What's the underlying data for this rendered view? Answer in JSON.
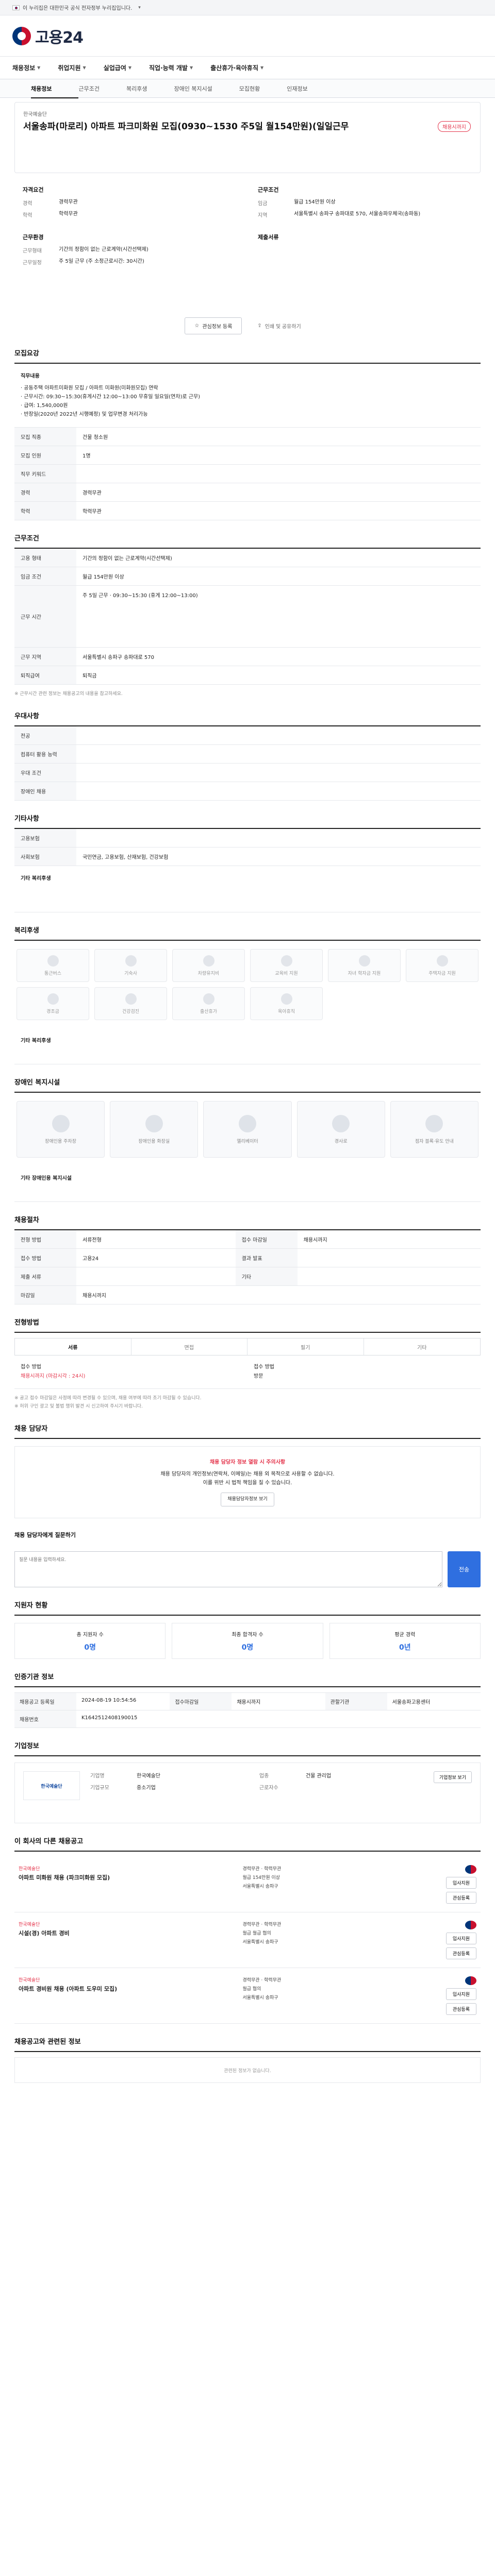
{
  "notice": "이 누리집은 대한민국 공식 전자정부 누리집입니다.",
  "site": {
    "name": "고용24"
  },
  "gnb": [
    {
      "label": "채용정보"
    },
    {
      "label": "취업지원"
    },
    {
      "label": "실업급여"
    },
    {
      "label": "직업·능력 개발"
    },
    {
      "label": "출산휴가·육아휴직"
    }
  ],
  "lnb": [
    {
      "label": "채용정보"
    },
    {
      "label": "근무조건"
    },
    {
      "label": "복리후생"
    },
    {
      "label": "장애인 복지시설"
    },
    {
      "label": "모집현황"
    },
    {
      "label": "인재정보"
    }
  ],
  "job": {
    "company": "한국예술단",
    "title": "서울송파(마로리) 아파트 파크미화원 모집(0930~1530 주5일 월154만원)(일일근무",
    "badge": "채용시까지"
  },
  "summary": {
    "left_title": "자격요건",
    "left": [
      {
        "k": "경력",
        "v": "경력무관"
      },
      {
        "k": "학력",
        "v": "학력무관"
      }
    ],
    "left2_title": "근무환경",
    "left2": [
      {
        "k": "근무형태",
        "v": "기간의 정함이 없는 근로계약(시간선택제)"
      },
      {
        "k": "근무일정",
        "v": "주 5일 근무 (주 소정근로시간: 30시간)"
      }
    ],
    "right_title": "근무조건",
    "right": [
      {
        "k": "임금",
        "v": "월급 154만원 이상"
      },
      {
        "k": "지역",
        "v": "서울특별시 송파구 송파대로 570, 서울송파우체국(송파동)"
      }
    ],
    "right2_title": "제출서류",
    "right2": [
      {
        "k": "",
        "v": ""
      }
    ]
  },
  "actions": {
    "apply": "관심정보 등록",
    "share": "인쇄 및 공유하기"
  },
  "recruit": {
    "title": "모집요강",
    "content_title": "직무내용",
    "content_lines": [
      "· 공동주택 아파트미화원 모집 / 아파트 미화원(미화원모집) 연락",
      "· 근무시간: 09:30~15:30(휴게시간 12:00~13:00 무휴일 일요일(연차)로 근무)",
      "· 급여: 1,540,000원",
      "· 반장일(2020년 2022년 시행예정) 및 업무변경 처리가능"
    ],
    "rows": [
      {
        "k": "모집 직종",
        "v": "건물 청소원"
      },
      {
        "k": "모집 인원",
        "v": "1명"
      },
      {
        "k": "직무 키워드",
        "v": ""
      },
      {
        "k": "경력",
        "v": "경력무관"
      },
      {
        "k": "학력",
        "v": "학력무관"
      }
    ]
  },
  "work": {
    "title": "근무조건",
    "rows": [
      {
        "k": "고용 형태",
        "v": "기간의 정함이 없는 근로계약(시간선택제)"
      },
      {
        "k": "임금 조건",
        "v": "월급 154만원 이상"
      },
      {
        "k": "근무 시간",
        "v": "주 5일 근무 · 09:30~15:30 (휴게 12:00~13:00)"
      },
      {
        "k": "근무 지역",
        "v": "서울특별시 송파구 송파대로 570"
      },
      {
        "k": "퇴직급여",
        "v": "퇴직금"
      }
    ],
    "note": "※ 근무시간 관련 정보는 채용공고의 내용을 참고하세요."
  },
  "skills": {
    "title": "우대사항",
    "rows": [
      {
        "k": "전공",
        "v": ""
      },
      {
        "k": "컴퓨터 활용 능력",
        "v": ""
      },
      {
        "k": "우대 조건",
        "v": ""
      },
      {
        "k": "장애인 채용",
        "v": ""
      }
    ]
  },
  "etc": {
    "title": "기타사항",
    "rows": [
      {
        "k": "고용보험",
        "v": ""
      },
      {
        "k": "사회보험",
        "v": "국민연금, 고용보험, 산재보험, 건강보험"
      }
    ],
    "extra_label": "기타 복리후생"
  },
  "welfare": {
    "title": "복리후생",
    "items": [
      "통근버스",
      "기숙사",
      "차량유지비",
      "교육비 지원",
      "자녀 학자금 지원",
      "주택자금 지원",
      "경조금",
      "건강검진",
      "출산휴가",
      "육아휴직"
    ],
    "extra": "기타 복리후생"
  },
  "facility": {
    "title": "장애인 복지시설",
    "items": [
      "장애인용 주차장",
      "장애인용 화장실",
      "엘리베이터",
      "경사로",
      "점자 블록·유도 안내"
    ],
    "extra": "기타 장애인용 복지시설"
  },
  "recruit_status": {
    "title": "채용절차",
    "rows": [
      {
        "k": "전형 방법",
        "v": "서류전형"
      },
      {
        "k": "접수 방법",
        "v": "고용24"
      },
      {
        "k": "제출 서류",
        "v": ""
      },
      {
        "k": "마감일",
        "v": "채용시까지"
      }
    ],
    "right_rows": [
      {
        "k": "접수 마감일",
        "v": "채용시까지"
      },
      {
        "k": "결과 발표",
        "v": ""
      },
      {
        "k": "기타",
        "v": ""
      }
    ]
  },
  "process": {
    "title": "전형방법",
    "tabs": [
      "서류",
      "면접",
      "필기",
      "기타"
    ],
    "left_label": "접수 방법",
    "left_value": "채용시까지 (마감시각 : 24시)",
    "right_label": "접수 방법",
    "right_value": "방문",
    "note_lines": [
      "※ 공고 접수 마감일은 사정에 따라 변경될 수 있으며, 채용 여부에 따라 조기 마감될 수 있습니다.",
      "※ 허위 구인 광고 및 불법 행위 발견 시 신고하여 주시기 바랍니다."
    ]
  },
  "contact": {
    "title": "채용 담당자",
    "warn": "채용 담당자 정보 열람 시 주의사항",
    "line1": "채용 담당자의 개인정보(연락처, 이메일)는 채용 외 목적으로 사용할 수 없습니다.",
    "line2": "이를 위반 시 법적 책임을 질 수 있습니다.",
    "pill": "채용담당자정보 보기"
  },
  "ask": {
    "title": "채용 담당자에게 질문하기",
    "placeholder": "질문 내용을 입력하세요.",
    "send": "전송"
  },
  "stats": {
    "title": "지원자 현황",
    "items": [
      {
        "label": "총 지원자 수",
        "value": "0명"
      },
      {
        "label": "최종 합격자 수",
        "value": "0명"
      },
      {
        "label": "평균 경력",
        "value": "0년"
      }
    ]
  },
  "ci": {
    "title": "인증기관 정보",
    "rows": [
      {
        "k": "채용공고 등록일",
        "v": "2024-08-19 10:54:56"
      },
      {
        "k": "접수마감일",
        "v": "채용시까지"
      },
      {
        "k": "관할기관",
        "v": "서울송파고용센터"
      },
      {
        "k": "채용번호",
        "v": "K1642512408190015"
      }
    ]
  },
  "company_info": {
    "title": "기업정보",
    "logo_text": "한국예술단",
    "rows": [
      {
        "k": "기업명",
        "v": "한국예술단"
      },
      {
        "k": "업종",
        "v": "건물 관리업"
      },
      {
        "k": "기업규모",
        "v": "중소기업"
      },
      {
        "k": "근로자수",
        "v": ""
      }
    ],
    "button": "기업정보 보기"
  },
  "others": {
    "title": "이 회사의 다른 채용공고",
    "items": [
      {
        "co": "한국예술단",
        "tt": "아파트 미화원 채용 (파크미화원 모집)",
        "meta": [
          "경력무관 · 학력무관",
          "월급 154만원 이상",
          "서울특별시 송파구"
        ]
      },
      {
        "co": "한국예술단",
        "tt": "시설(경) 아파트 경비",
        "meta": [
          "경력무관 · 학력무관",
          "월급 월급 협의",
          "서울특별시 송파구"
        ]
      },
      {
        "co": "한국예술단",
        "tt": "아파트 경비원 채용 (아파트 도우미 모집)",
        "meta": [
          "경력무관 · 학력무관",
          "월급 협의",
          "서울특별시 송파구"
        ]
      }
    ],
    "btn_apply": "입사지원",
    "btn_save": "관심등록"
  },
  "recent": {
    "title": "채용공고와 관련된 정보",
    "empty": "관련된 정보가 없습니다."
  }
}
